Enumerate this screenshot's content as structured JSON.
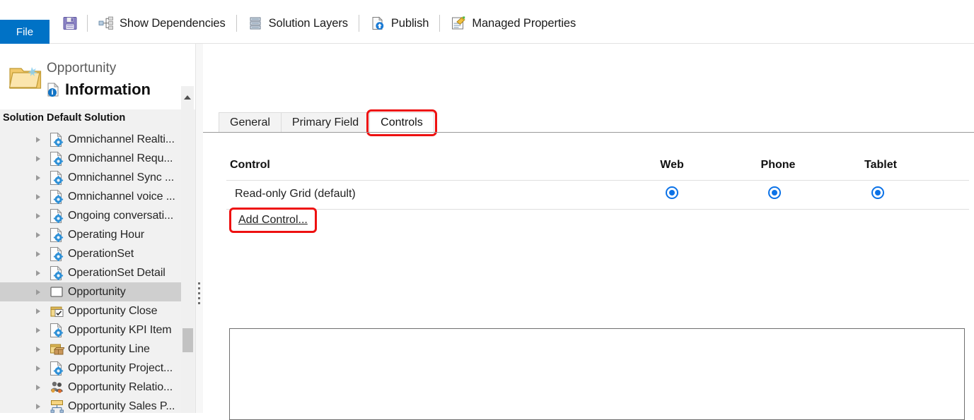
{
  "ribbon": {
    "file_tab": "File",
    "save_icon": "save-icon",
    "items": [
      {
        "label": "Show Dependencies",
        "icon": "dependencies-icon"
      },
      {
        "label": "Solution Layers",
        "icon": "layers-icon"
      },
      {
        "label": "Publish",
        "icon": "publish-icon"
      },
      {
        "label": "Managed Properties",
        "icon": "managed-properties-icon"
      }
    ]
  },
  "left_panel": {
    "entity_name": "Opportunity",
    "section_title": "Information",
    "solution_label": "Solution Default Solution",
    "folder_icon": "folder-icon",
    "info_icon": "information-icon",
    "tree": [
      {
        "label": "Omnichannel Realti...",
        "icon": "entity-gear-icon",
        "selected": false
      },
      {
        "label": "Omnichannel Requ...",
        "icon": "entity-gear-icon",
        "selected": false
      },
      {
        "label": "Omnichannel Sync ...",
        "icon": "entity-gear-icon",
        "selected": false
      },
      {
        "label": "Omnichannel voice ...",
        "icon": "entity-gear-icon",
        "selected": false
      },
      {
        "label": "Ongoing conversati...",
        "icon": "entity-gear-icon",
        "selected": false
      },
      {
        "label": "Operating Hour",
        "icon": "entity-gear-icon",
        "selected": false
      },
      {
        "label": "OperationSet",
        "icon": "entity-gear-icon",
        "selected": false
      },
      {
        "label": "OperationSet Detail",
        "icon": "entity-gear-icon",
        "selected": false
      },
      {
        "label": "Opportunity",
        "icon": "entity-plain-icon",
        "selected": true
      },
      {
        "label": "Opportunity Close",
        "icon": "entity-check-icon",
        "selected": false
      },
      {
        "label": "Opportunity KPI Item",
        "icon": "entity-gear-icon",
        "selected": false
      },
      {
        "label": "Opportunity Line",
        "icon": "entity-box-icon",
        "selected": false
      },
      {
        "label": "Opportunity Project...",
        "icon": "entity-gear-icon",
        "selected": false
      },
      {
        "label": "Opportunity Relatio...",
        "icon": "entity-people-icon",
        "selected": false
      },
      {
        "label": "Opportunity Sales P...",
        "icon": "entity-process-icon",
        "selected": false
      }
    ]
  },
  "main": {
    "tabs": [
      {
        "label": "General",
        "active": false,
        "highlighted": false
      },
      {
        "label": "Primary Field",
        "active": false,
        "highlighted": false
      },
      {
        "label": "Controls",
        "active": true,
        "highlighted": true
      }
    ],
    "grid": {
      "columns": {
        "control": "Control",
        "web": "Web",
        "phone": "Phone",
        "tablet": "Tablet"
      },
      "rows": [
        {
          "name": "Read-only Grid (default)",
          "web_selected": true,
          "phone_selected": true,
          "tablet_selected": true
        }
      ]
    },
    "add_control_label": "Add Control..."
  },
  "colors": {
    "file_tab_blue": "#0072c6",
    "radio_blue": "#0b72e7",
    "highlight_red": "#ee1111",
    "panel_gray": "#f1f1f1",
    "selected_row_gray": "#cfcfcf"
  }
}
